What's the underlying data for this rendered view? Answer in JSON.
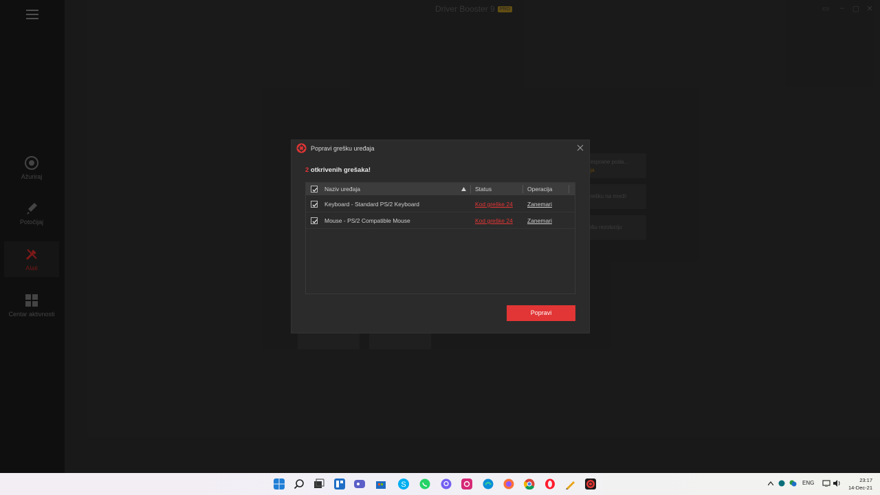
{
  "app": {
    "title": "Driver Booster 9",
    "badge": "PRO"
  },
  "sidebar": {
    "items": [
      {
        "label": "Ažuriraj",
        "icon": "update-icon"
      },
      {
        "label": "Potočijaj",
        "icon": "rocket-icon"
      },
      {
        "label": "Alati",
        "icon": "tools-icon"
      },
      {
        "label": "Centar aktivnosti",
        "icon": "grid-icon"
      }
    ]
  },
  "background_cards": [
    {
      "text": "nesprane poda...",
      "accent": "aja"
    },
    {
      "text": "grešku na mreži",
      "accent": ""
    },
    {
      "text": "lošu rezoluciju",
      "accent": ""
    }
  ],
  "dialog": {
    "title": "Popravi grešku uređaja",
    "headline_count": "2",
    "headline_text": " otkrivenih grešaka!",
    "columns": {
      "name": "Naziv uređaja",
      "status": "Status",
      "operation": "Operacija"
    },
    "rows": [
      {
        "name": "Keyboard - Standard PS/2 Keyboard",
        "status": "Kod greške 24",
        "operation": "Zanemari"
      },
      {
        "name": "Mouse - PS/2 Compatible Mouse",
        "status": "Kod greške 24",
        "operation": "Zanemari"
      }
    ],
    "fix_button": "Popravi"
  },
  "taskbar": {
    "language": "ENG",
    "time": "23:17",
    "date": "14-Dec-21"
  },
  "colors": {
    "accent": "#e23535",
    "dialog_bg": "#2b2b2b",
    "header_bg": "#3c3c3c"
  }
}
